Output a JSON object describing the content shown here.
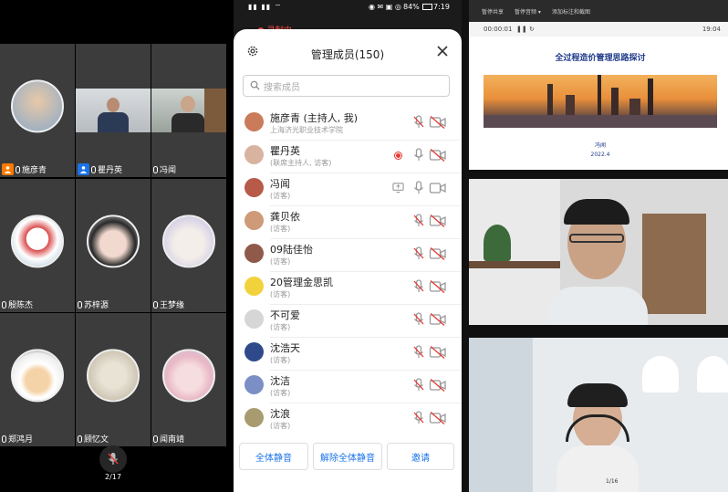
{
  "gallery": {
    "tiles": [
      {
        "name": "施彦青",
        "host": true,
        "badge_color": "#ff7a00"
      },
      {
        "name": "瞿丹英",
        "host": true,
        "badge_color": "#1a73e8"
      },
      {
        "name": "冯闻",
        "host": false
      },
      {
        "name": "殷陈杰",
        "host": false
      },
      {
        "name": "苏梓源",
        "host": false
      },
      {
        "name": "王梦缘",
        "host": false
      },
      {
        "name": "郑鸿月",
        "host": false
      },
      {
        "name": "顾忆文",
        "host": false
      },
      {
        "name": "闻南靖",
        "host": false
      }
    ],
    "page_indicator": "2/17"
  },
  "phone": {
    "status_time": "7:19",
    "battery": "84%",
    "recording_label": "录制中",
    "title": "管理成员(150)",
    "search_placeholder": "搜索成员",
    "members": [
      {
        "name": "施彦青 (主持人, 我)",
        "sub": "上海济光职业技术学院",
        "mic_muted": true,
        "cam_off": true
      },
      {
        "name": "瞿丹英",
        "sub": "(联席主持人, 访客)",
        "recording": true,
        "mic_muted": false,
        "cam_off": true
      },
      {
        "name": "冯闻",
        "sub": "(访客)",
        "sharing": true,
        "mic_muted": false,
        "cam_off": false
      },
      {
        "name": "龚贝依",
        "sub": "(访客)",
        "mic_muted": true,
        "cam_off": true
      },
      {
        "name": "09陆佳怡",
        "sub": "(访客)",
        "mic_muted": true,
        "cam_off": true
      },
      {
        "name": "20管理金思凯",
        "sub": "(访客)",
        "mic_muted": true,
        "cam_off": true
      },
      {
        "name": "不可爱",
        "sub": "(访客)",
        "mic_muted": true,
        "cam_off": true
      },
      {
        "name": "沈浩天",
        "sub": "(访客)",
        "mic_muted": true,
        "cam_off": true
      },
      {
        "name": "沈洁",
        "sub": "(访客)",
        "mic_muted": true,
        "cam_off": true
      },
      {
        "name": "沈浪",
        "sub": "(访客)",
        "mic_muted": true,
        "cam_off": true
      }
    ],
    "actions": {
      "mute_all": "全体静音",
      "unmute_all": "解除全体静音",
      "invite": "邀请"
    }
  },
  "presentation": {
    "toolbar": [
      "暂停共享",
      "暂停音频 ▾",
      "添加标注和截图"
    ],
    "elapsed": "00:00:01",
    "clock": "19:04",
    "title": "全过程造价管理思路探讨",
    "author": "冯闻",
    "date": "2022.4"
  },
  "right_pager": "1/16",
  "colors": {
    "accent": "#1a73e8",
    "muted_red": "#e53935",
    "host_orange": "#ff7a00"
  }
}
